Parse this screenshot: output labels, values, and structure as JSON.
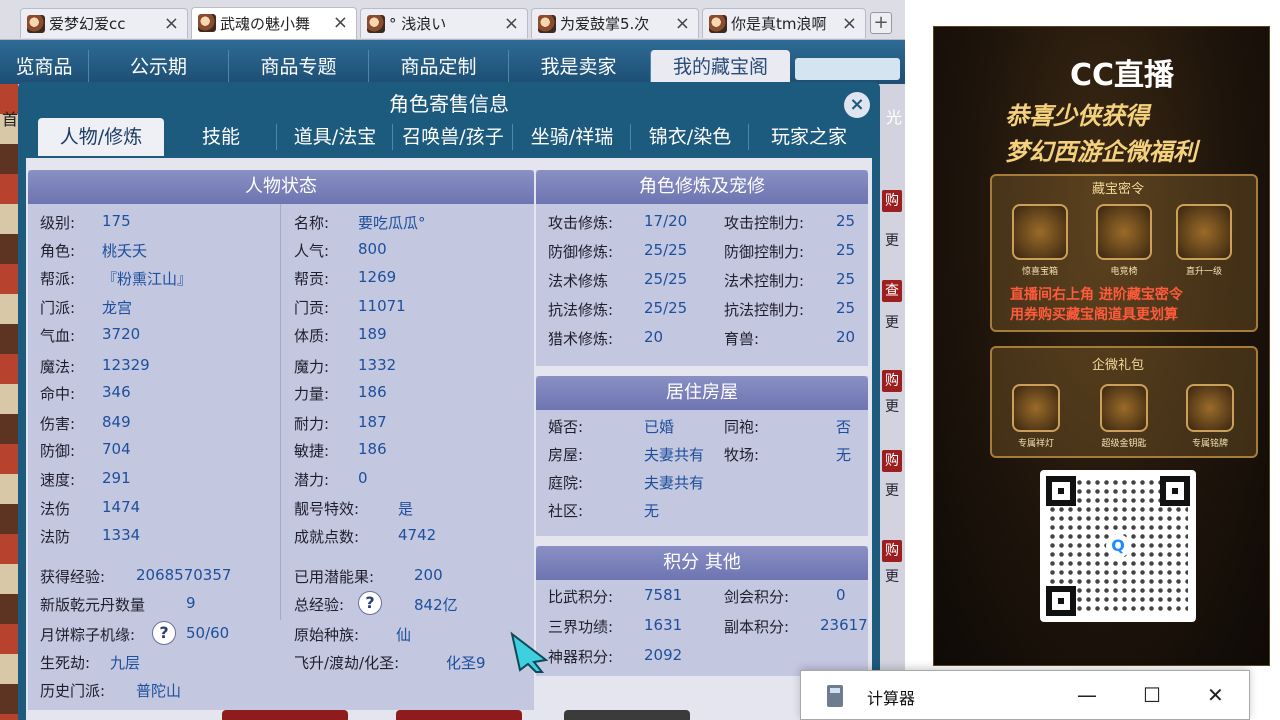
{
  "browser_tabs": [
    {
      "label": "爱梦幻爱cc",
      "active": false
    },
    {
      "label": "武魂の魅小舞",
      "active": true
    },
    {
      "label": "° 浅浪い",
      "active": false
    },
    {
      "label": "为爱鼓掌5.次",
      "active": false
    },
    {
      "label": "你是真tm浪啊",
      "active": false
    }
  ],
  "new_tab_label": "+",
  "site_nav": [
    "览商品",
    "公示期",
    "商品专题",
    "商品定制",
    "我是卖家",
    "我的藏宝阁"
  ],
  "background_tags": [
    "购",
    "更",
    "查",
    "更",
    "购",
    "更",
    "购",
    "更",
    "购",
    "更"
  ],
  "background_hint": "首",
  "background_hint_right": "光",
  "modal": {
    "title": "角色寄售信息",
    "close_label": "×",
    "tabs": [
      "人物/修炼",
      "技能",
      "道具/法宝",
      "召唤兽/孩子",
      "坐骑/祥瑞",
      "锦衣/染色",
      "玩家之家"
    ],
    "status": {
      "title": "人物状态",
      "left": [
        {
          "label": "级别:",
          "value": "175"
        },
        {
          "label": "角色:",
          "value": "桃夭夭"
        },
        {
          "label": "帮派:",
          "value": "『粉熏江山』"
        },
        {
          "label": "门派:",
          "value": "龙宫"
        },
        {
          "label": "气血:",
          "value": "3720"
        },
        {
          "label": "魔法:",
          "value": "12329"
        },
        {
          "label": "命中:",
          "value": "346"
        },
        {
          "label": "伤害:",
          "value": "849"
        },
        {
          "label": "防御:",
          "value": "704"
        },
        {
          "label": "速度:",
          "value": "291"
        },
        {
          "label": "法伤",
          "value": "1474"
        },
        {
          "label": "法防",
          "value": "1334"
        }
      ],
      "right": [
        {
          "label": "名称:",
          "value": "要吃瓜瓜°"
        },
        {
          "label": "人气:",
          "value": "800"
        },
        {
          "label": "帮贡:",
          "value": "1269"
        },
        {
          "label": "门贡:",
          "value": "11071"
        },
        {
          "label": "体质:",
          "value": "189"
        },
        {
          "label": "魔力:",
          "value": "1332"
        },
        {
          "label": "力量:",
          "value": "186"
        },
        {
          "label": "耐力:",
          "value": "187"
        },
        {
          "label": "敏捷:",
          "value": "186"
        },
        {
          "label": "潜力:",
          "value": "0"
        },
        {
          "label": "靓号特效:",
          "value": "是"
        },
        {
          "label": "成就点数:",
          "value": "4742"
        }
      ],
      "exp_label": "获得经验:",
      "exp_value": "2068570357",
      "potential_label": "已用潜能果:",
      "potential_value": "200",
      "pill_label": "新版乾元丹数量",
      "pill_value": "9",
      "total_exp_label": "总经验:",
      "total_exp_value": "842亿",
      "mooncake_label": "月饼粽子机缘:",
      "mooncake_value": "50/60",
      "race_label": "原始种族:",
      "race_value": "仙",
      "lifedeath_label": "生死劫:",
      "lifedeath_value": "九层",
      "ascend_label": "飞升/渡劫/化圣:",
      "ascend_value": "化圣9",
      "history_label": "历史门派:",
      "history_value": "普陀山",
      "qmark": "?"
    },
    "cultivation": {
      "title": "角色修炼及宠修",
      "rows": [
        {
          "l1": "攻击修炼:",
          "v1": "17/20",
          "l2": "攻击控制力:",
          "v2": "25"
        },
        {
          "l1": "防御修炼:",
          "v1": "25/25",
          "l2": "防御控制力:",
          "v2": "25"
        },
        {
          "l1": "法术修炼",
          "v1": "25/25",
          "l2": "法术控制力:",
          "v2": "25"
        },
        {
          "l1": "抗法修炼:",
          "v1": "25/25",
          "l2": "抗法控制力:",
          "v2": "25"
        },
        {
          "l1": "猎术修炼:",
          "v1": "20",
          "l2": "育兽:",
          "v2": "20"
        }
      ]
    },
    "housing": {
      "title": "居住房屋",
      "rows": [
        {
          "l1": "婚否:",
          "v1": "已婚",
          "l2": "同袍:",
          "v2": "否"
        },
        {
          "l1": "房屋:",
          "v1": "夫妻共有",
          "l2": "牧场:",
          "v2": "无"
        },
        {
          "l1": "庭院:",
          "v1": "夫妻共有",
          "l2": "",
          "v2": ""
        },
        {
          "l1": "社区:",
          "v1": "无",
          "l2": "",
          "v2": ""
        }
      ]
    },
    "points": {
      "title": "积分 其他",
      "rows": [
        {
          "l1": "比武积分:",
          "v1": "7581",
          "l2": "剑会积分:",
          "v2": "0"
        },
        {
          "l1": "三界功绩:",
          "v1": "1631",
          "l2": "副本积分:",
          "v2": "23617"
        },
        {
          "l1": "神器积分:",
          "v1": "2092",
          "l2": "",
          "v2": ""
        }
      ]
    }
  },
  "cc_ad": {
    "topright": "CC直播",
    "logo": "CC直播",
    "headline1": "恭喜少侠获得",
    "headline2": "梦幻西游企微福利",
    "box1_title": "藏宝密令",
    "box1_items": [
      "惊喜宝箱",
      "电竞椅",
      "直升一级"
    ],
    "box1_red1": "直播间右上角 进阶藏宝密令",
    "box1_red2": "用券购买藏宝阁道具更划算",
    "box2_title": "企微礼包",
    "box2_items": [
      "专属祥灯",
      "超级金钥匙",
      "专属铭牌"
    ],
    "qr_center": "Q"
  },
  "calculator": {
    "title": "计算器",
    "minimize": "—",
    "maximize": "☐",
    "close": "✕"
  }
}
